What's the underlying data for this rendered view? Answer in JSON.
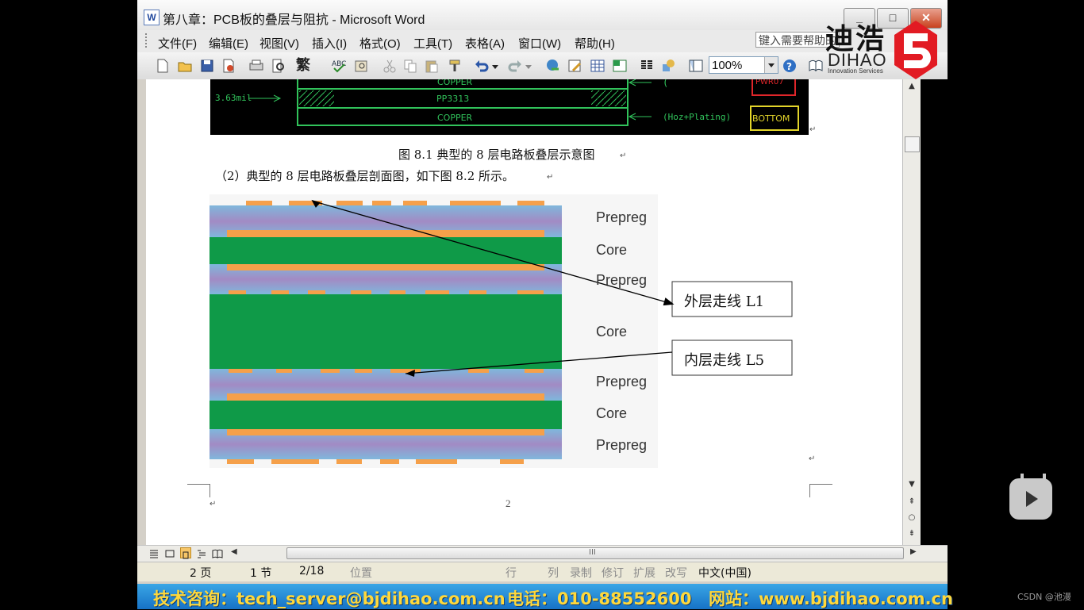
{
  "window": {
    "title": "第八章：PCB板的叠层与阻抗 - Microsoft Word",
    "app_icon": "word-doc-icon",
    "controls": [
      "minimize-icon",
      "maximize-icon",
      "close-icon"
    ],
    "close_glyph": "✕"
  },
  "menu": {
    "items": [
      "文件(F)",
      "编辑(E)",
      "视图(V)",
      "插入(I)",
      "格式(O)",
      "工具(T)",
      "表格(A)",
      "窗口(W)",
      "帮助(H)"
    ],
    "help_placeholder": "键入需要帮助的问题"
  },
  "toolbar": {
    "zoom": "100%",
    "traditional_label": "繁",
    "icons": [
      "new-icon",
      "open-icon",
      "save-icon",
      "permission-icon",
      "print-icon",
      "print-preview-icon",
      "traditional-chinese-icon",
      "spelling-icon",
      "research-icon",
      "cut-icon",
      "copy-icon",
      "paste-icon",
      "format-painter-icon",
      "undo-icon",
      "redo-icon",
      "hyperlink-icon",
      "tables-borders-icon",
      "insert-table-icon",
      "insert-excel-icon",
      "columns-icon",
      "drawing-icon",
      "document-map-icon",
      "help-icon",
      "read-icon"
    ]
  },
  "logo": {
    "chinese": "迪浩",
    "english": "DIHAO",
    "tagline": "Innovation Services"
  },
  "document": {
    "cad_top": {
      "left_label": "3.63mil",
      "rows": [
        "COPPER",
        "PP3313",
        "COPPER"
      ],
      "right_label": "(Hoz+Plating)",
      "right_label_top": "(",
      "tags": [
        "PWR07",
        "BOTTOM"
      ]
    },
    "caption": "图 8.1  典型的 8 层电路板叠层示意图",
    "paragraph": "（2）典型的 8 层电路板叠层剖面图，如下图 8.2 所示。",
    "figure": {
      "layer_labels": [
        "Prepreg",
        "Core",
        "Prepreg",
        "Core",
        "Prepreg",
        "Core",
        "Prepreg"
      ],
      "callouts": [
        "外层走线 L1",
        "内层走线 L5"
      ],
      "colors": {
        "copper": "#f5a04a",
        "core": "#0f9a48",
        "prepreg": "#9b8fc2"
      }
    },
    "page_number": "2",
    "para_mark": "↵"
  },
  "scrollbar": {
    "up": "▲",
    "down": "▼",
    "prev_page": "⇞",
    "select_browse": "○",
    "next_page": "⇟",
    "left": "◀",
    "right": "▶",
    "grip": "III"
  },
  "status": {
    "page": "2 页",
    "section": "1 节",
    "page_of": "2/18",
    "position": "位置",
    "line": "行",
    "col": "列",
    "rec": "录制",
    "trk": "修订",
    "ext": "扩展",
    "ovr": "改写",
    "language": "中文(中国)"
  },
  "banner": {
    "tech": "技术咨询：tech_server@bjdihao.com.cn",
    "phone": "电话：010-88552600",
    "site": "网站：www.bjdihao.com.cn"
  },
  "overlay": {
    "watermark": "CSDN @池漫"
  }
}
